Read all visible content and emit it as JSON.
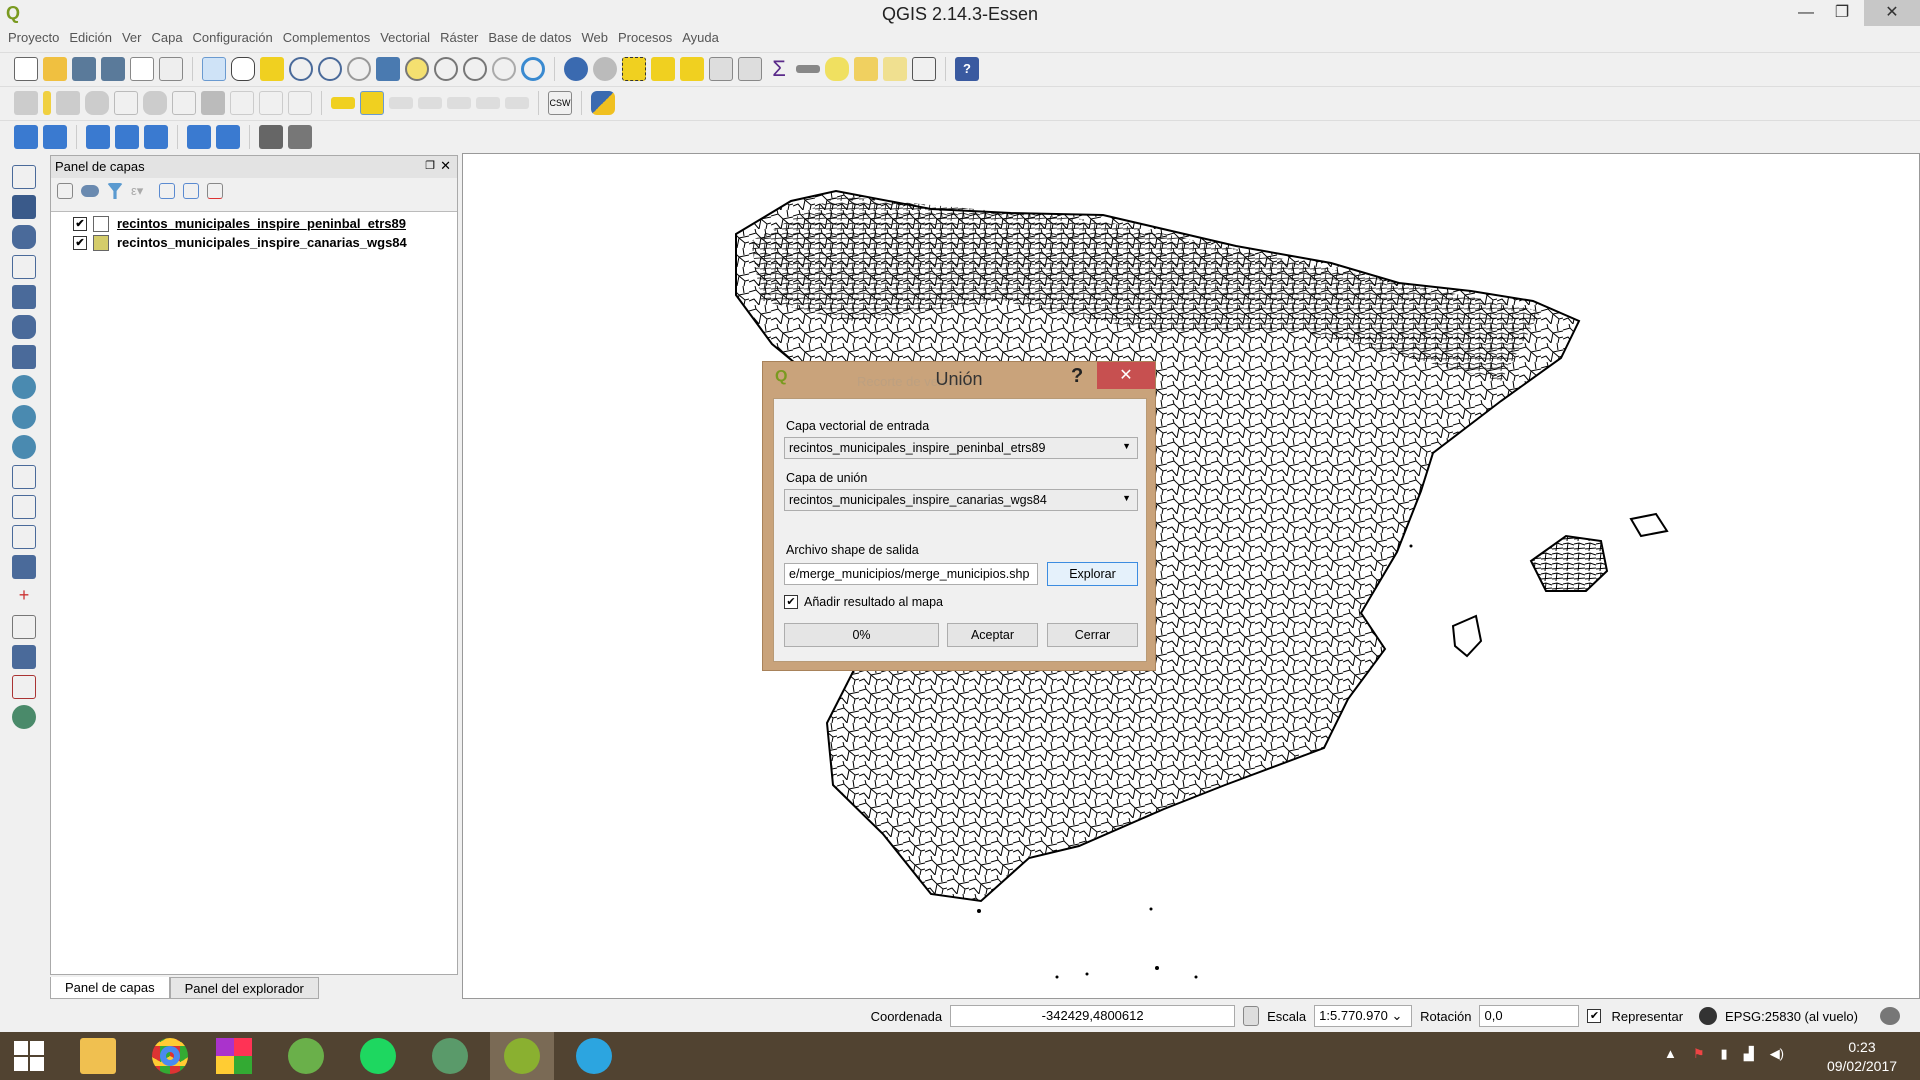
{
  "window": {
    "title": "QGIS 2.14.3-Essen",
    "minimize": "—",
    "maximize": "❐",
    "close": "✕"
  },
  "menu": [
    "Proyecto",
    "Edición",
    "Ver",
    "Capa",
    "Configuración",
    "Complementos",
    "Vectorial",
    "Ráster",
    "Base de datos",
    "Web",
    "Procesos",
    "Ayuda"
  ],
  "layers_panel": {
    "title": "Panel de capas",
    "layers": [
      {
        "name": "recintos_municipales_inspire_peninbal_etrs89",
        "checked": true,
        "color": "#ffffff"
      },
      {
        "name": "recintos_municipales_inspire_canarias_wgs84",
        "checked": true,
        "color": "#d4cc6a"
      }
    ],
    "tabs": [
      "Panel de capas",
      "Panel del explorador"
    ]
  },
  "dialog": {
    "title": "Unión",
    "ghost_title": "Recorte de ventana",
    "help": "?",
    "close": "✕",
    "input_label": "Capa vectorial de entrada",
    "input_value": "recintos_municipales_inspire_peninbal_etrs89",
    "union_label": "Capa de unión",
    "union_value": "recintos_municipales_inspire_canarias_wgs84",
    "output_label": "Archivo shape de salida",
    "output_value": "e/merge_municipios/merge_municipios.shp",
    "browse": "Explorar",
    "add_checked": true,
    "add_label": "Añadir resultado al mapa",
    "progress": "0%",
    "progress_value": 0,
    "accept": "Aceptar",
    "close_btn": "Cerrar"
  },
  "status": {
    "coord_label": "Coordenada",
    "coord": "-342429,4800612",
    "scale_label": "Escala",
    "scale": "1:5.770.970",
    "rotation_label": "Rotación",
    "rotation": "0,0",
    "render_label": "Representar",
    "render_checked": true,
    "crs": "EPSG:25830 (al vuelo)"
  },
  "taskbar": {
    "time": "0:23",
    "date": "09/02/2017"
  }
}
